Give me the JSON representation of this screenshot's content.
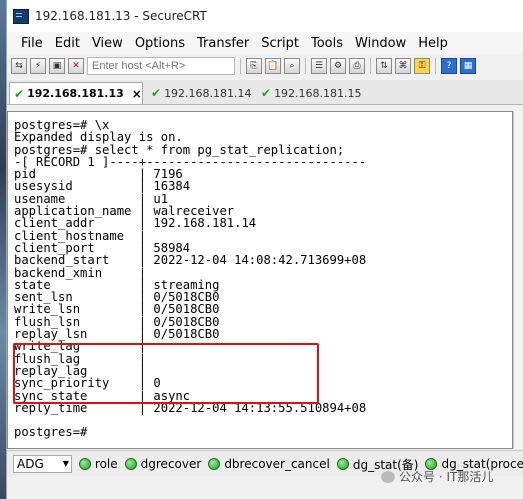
{
  "window": {
    "title": "192.168.181.13 - SecureCRT"
  },
  "menu": [
    "File",
    "Edit",
    "View",
    "Options",
    "Transfer",
    "Script",
    "Tools",
    "Window",
    "Help"
  ],
  "toolbar": {
    "host_placeholder": "Enter host <Alt+R>"
  },
  "tabs": [
    {
      "label": "192.168.181.13",
      "close": "×",
      "active": true
    },
    {
      "label": "192.168.181.14",
      "active": false
    },
    {
      "label": "192.168.181.15",
      "active": false
    }
  ],
  "terminal": {
    "lines": [
      "postgres=# \\x",
      "Expanded display is on.",
      "postgres=# select * from pg_stat_replication;",
      "-[ RECORD 1 ]----+------------------------------",
      "pid              | 7196",
      "usesysid         | 16384",
      "usename          | u1",
      "application_name | walreceiver",
      "client_addr      | 192.168.181.14",
      "client_hostname  |",
      "client_port      | 58984",
      "backend_start    | 2022-12-04 14:08:42.713699+08",
      "backend_xmin     |",
      "state            | streaming",
      "sent_lsn         | 0/5018CB0",
      "write_lsn        | 0/5018CB0",
      "flush_lsn        | 0/5018CB0",
      "replay_lsn       | 0/5018CB0",
      "write_lag        |",
      "flush_lag        |",
      "replay_lag       |",
      "sync_priority    | 0",
      "sync_state       | async",
      "reply_time       | 2022-12-04 14:13:55.510894+08",
      "",
      "postgres=#"
    ]
  },
  "bottom": {
    "select_value": "ADG",
    "buttons": [
      "role",
      "dgrecover",
      "dbrecover_cancel",
      "dg_stat(备)",
      "dg_stat(proce"
    ]
  },
  "watermark": "公众号 · IT那活儿",
  "colors": {
    "highlight": "#e01010",
    "tab_check": "#1fa21f"
  }
}
